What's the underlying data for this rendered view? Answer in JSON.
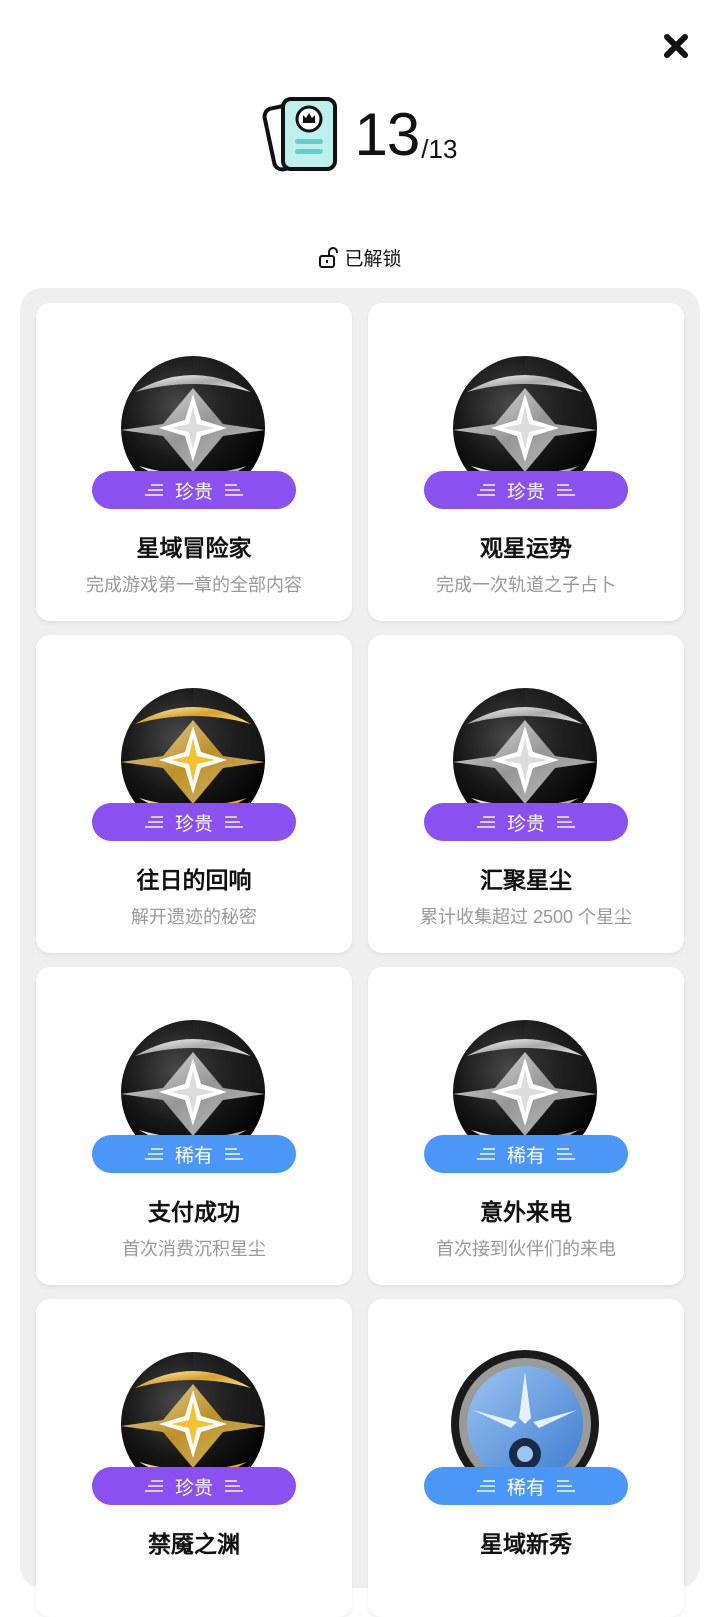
{
  "header": {
    "count": "13",
    "total": "/13",
    "status_label": "已解锁"
  },
  "colors": {
    "rare_purple": "#8a50f0",
    "rare_blue": "#4c96f7"
  },
  "achievements": [
    {
      "title": "星域冒险家",
      "desc": "完成游戏第一章的全部内容",
      "tier": "珍贵",
      "color": "purple",
      "badge": "silver-star-emblem"
    },
    {
      "title": "观星运势",
      "desc": "完成一次轨道之子占卜",
      "tier": "珍贵",
      "color": "purple",
      "badge": "silver-star-emblem"
    },
    {
      "title": "往日的回响",
      "desc": "解开遗迹的秘密",
      "tier": "珍贵",
      "color": "purple",
      "badge": "gold-star-emblem"
    },
    {
      "title": "汇聚星尘",
      "desc": "累计收集超过 2500 个星尘",
      "tier": "珍贵",
      "color": "purple",
      "badge": "silver-star-emblem"
    },
    {
      "title": "支付成功",
      "desc": "首次消费沉积星尘",
      "tier": "稀有",
      "color": "blue",
      "badge": "silver-star-emblem"
    },
    {
      "title": "意外来电",
      "desc": "首次接到伙伴们的来电",
      "tier": "稀有",
      "color": "blue",
      "badge": "silver-star-emblem"
    },
    {
      "title": "禁魇之渊",
      "desc": "",
      "tier": "珍贵",
      "color": "purple",
      "badge": "gold-star-emblem"
    },
    {
      "title": "星域新秀",
      "desc": "",
      "tier": "稀有",
      "color": "blue",
      "badge": "blue-compass-emblem"
    }
  ]
}
